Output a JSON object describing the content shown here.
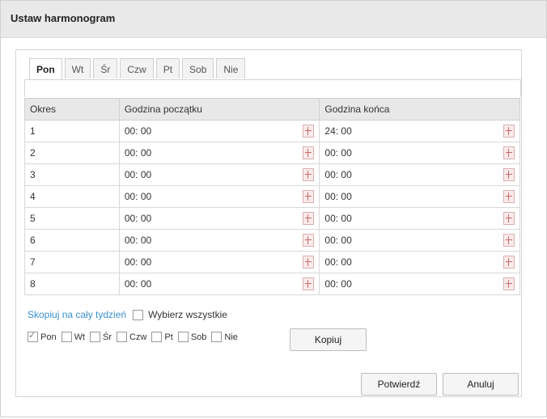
{
  "dialog": {
    "title": "Ustaw harmonogram"
  },
  "tabs": [
    {
      "label": "Pon",
      "active": true
    },
    {
      "label": "Wt",
      "active": false
    },
    {
      "label": "Śr",
      "active": false
    },
    {
      "label": "Czw",
      "active": false
    },
    {
      "label": "Pt",
      "active": false
    },
    {
      "label": "Sob",
      "active": false
    },
    {
      "label": "Nie",
      "active": false
    }
  ],
  "table": {
    "headers": [
      "Okres",
      "Godzina początku",
      "Godzina końca"
    ],
    "rows": [
      {
        "period": "1",
        "start": "00: 00",
        "end": "24: 00"
      },
      {
        "period": "2",
        "start": "00: 00",
        "end": "00: 00"
      },
      {
        "period": "3",
        "start": "00: 00",
        "end": "00: 00"
      },
      {
        "period": "4",
        "start": "00: 00",
        "end": "00: 00"
      },
      {
        "period": "5",
        "start": "00: 00",
        "end": "00: 00"
      },
      {
        "period": "6",
        "start": "00: 00",
        "end": "00: 00"
      },
      {
        "period": "7",
        "start": "00: 00",
        "end": "00: 00"
      },
      {
        "period": "8",
        "start": "00: 00",
        "end": "00: 00"
      }
    ]
  },
  "copy": {
    "link_label": "Skopiuj na cały tydzień",
    "select_all_label": "Wybierz wszystkie",
    "select_all_checked": false,
    "days": [
      {
        "label": "Pon",
        "checked": true
      },
      {
        "label": "Wt",
        "checked": false
      },
      {
        "label": "Śr",
        "checked": false
      },
      {
        "label": "Czw",
        "checked": false
      },
      {
        "label": "Pt",
        "checked": false
      },
      {
        "label": "Sob",
        "checked": false
      },
      {
        "label": "Nie",
        "checked": false
      }
    ],
    "copy_button": "Kopiuj"
  },
  "footer": {
    "confirm_label": "Potwierdź",
    "cancel_label": "Anuluj"
  },
  "colors": {
    "link": "#3a8fd0",
    "header_bg": "#e9e9e9",
    "clock_icon": "#c86a6a"
  },
  "icons": {
    "time_picker": "clock-icon"
  }
}
